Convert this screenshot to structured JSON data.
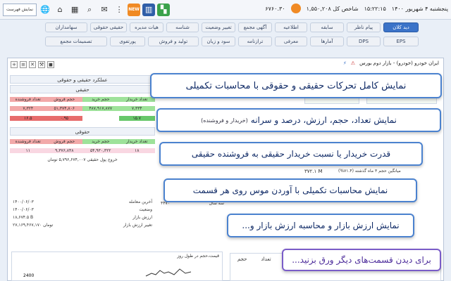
{
  "topbar": {
    "btn_label": "نمایش فهرست",
    "news_badge": "NEW",
    "date": "پنجشنبه ۴ شهریور ۱۴۰۰",
    "time": "۱۵:۲۲:۱۵",
    "index_label": "شاخص کل ۱,۵۵۰,۲۰۸",
    "index_change": "۶۷۶۰.۳۰"
  },
  "menu": {
    "row1": [
      "دید کلان",
      "پیام ناظر",
      "سابقه",
      "اطلاعیه",
      "آگهی مجمع",
      "تغییر وضعیت",
      "شناسه",
      "هیات مدیره",
      "حقیقی حقوقی",
      "سهامداران"
    ],
    "row2": [
      "EPS",
      "DPS",
      "آمارها",
      "معرفی",
      "ترازنامه",
      "سود و زیان",
      "تولید و فروش",
      "پورتفوی",
      "تصمیمات مجمع"
    ]
  },
  "panel": {
    "title": "ایران خودرو (خودرو) - بازار دوم بورس"
  },
  "left_table": {
    "header": "عملکرد حقیقی و حقوقی",
    "real_label": "حقیقی",
    "cols": [
      "تعداد فروشنده",
      "حجم فروش",
      "حجم خرید",
      "تعداد خریدار"
    ],
    "real_row1": [
      "۷,۳۲۴",
      "۵۱,۳۷۴,۸۰۶",
      "۴۸۷,۹۱۷,۸۷۷",
      "۷,۳۳۴"
    ],
    "real_row2": [
      "۱۶.۵",
      "۰.۹۵",
      "",
      "۱۵.۷"
    ],
    "legal_label": "حقوقی",
    "legal_row1": [
      "۱۱",
      "۹,۳۷۶,۸۴۸",
      "۵۴,۹۳۰,۳۲۲",
      "۱۸"
    ],
    "flow": "خروج پول حقیقی ۵,۷۹۶,۶۷۴,۰۰۷ تومان"
  },
  "info": {
    "rows": [
      [
        "۱۴۰۰/۰۶/۰۳",
        "آخرین معامله"
      ],
      [
        "۱۴۰۰/۰۶/۰۳",
        "وضعیت"
      ],
      [
        "۱۸,۶۷۴.۵ B",
        "ارزش بازار"
      ],
      [
        "۲۷,۱۶۹,۴۶۷,۱۷۰ تومان",
        "تغییر ارزش بازار"
      ]
    ]
  },
  "mid": {
    "val": "۴۴۷۰",
    "label": "سه سال"
  },
  "right": {
    "pct1": "۰.۱۰ %",
    "pct2": "۲.۵۶ %",
    "vol": "۳۷۲.۱ M",
    "vol_label": "میانگین حجم ۳ ماه گذشته (۷۱.۴%)"
  },
  "chart": {
    "title": "قیمت،حجم در طول روز",
    "axis_tick": "2400"
  },
  "rbox": {
    "cols": [
      "حجم",
      "تعداد"
    ]
  },
  "banners": [
    "نمایش کامل تحرکات حقیقی و حقوقی با محاسبات تکمیلی",
    "نمایش تعداد، حجم، ارزش، درصد و سرانه",
    "(خریدار و فروشنده)",
    "قدرت خریدار یا نسبت خریدار حقیقی به فروشنده حقیقی",
    "نمایش محاسبات تکمیلی با آوردن موس روی هر قسمت",
    "نمایش ارزش بازار و محاسبه ارزش بازار و...",
    "برای دیدن قسمت‌های دیگر ورق بزنید..."
  ],
  "colors": {
    "accent": "#3b73c8",
    "banner_border": "#4b82cf",
    "buy_green": "#9ee29a",
    "sell_red": "#f2a9a9"
  }
}
